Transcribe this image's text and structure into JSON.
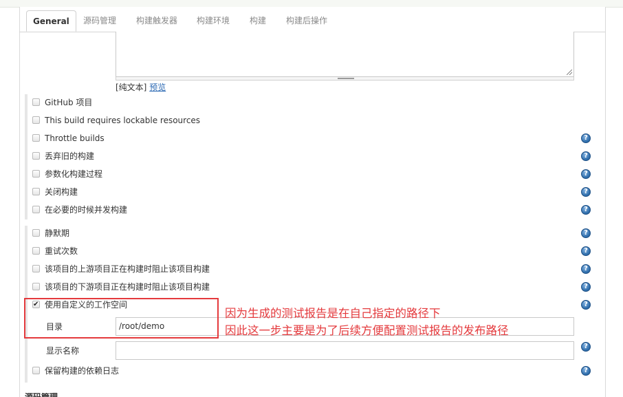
{
  "tabs": [
    {
      "label": "General",
      "active": true
    },
    {
      "label": "源码管理"
    },
    {
      "label": "构建触发器"
    },
    {
      "label": "构建环境"
    },
    {
      "label": "构建"
    },
    {
      "label": "构建后操作"
    }
  ],
  "description": {
    "value": "",
    "plain_text": "[纯文本]",
    "preview": "预览"
  },
  "options_group1": [
    {
      "label": "GitHub 项目",
      "checked": false,
      "help": false
    },
    {
      "label": "This build requires lockable resources",
      "checked": false,
      "help": false
    },
    {
      "label": "Throttle builds",
      "checked": false,
      "help": true
    },
    {
      "label": "丢弃旧的构建",
      "checked": false,
      "help": true
    },
    {
      "label": "参数化构建过程",
      "checked": false,
      "help": true
    },
    {
      "label": "关闭构建",
      "checked": false,
      "help": true
    },
    {
      "label": "在必要的时候并发构建",
      "checked": false,
      "help": true
    }
  ],
  "options_group2": [
    {
      "label": "静默期",
      "checked": false,
      "help": true
    },
    {
      "label": "重试次数",
      "checked": false,
      "help": true
    },
    {
      "label": "该项目的上游项目正在构建时阻止该项目构建",
      "checked": false,
      "help": true
    },
    {
      "label": "该项目的下游项目正在构建时阻止该项目构建",
      "checked": false,
      "help": true
    },
    {
      "label": "使用自定义的工作空间",
      "checked": true,
      "help": true
    }
  ],
  "custom_workspace": {
    "dir_label": "目录",
    "dir_value": "/root/demo",
    "display_name_label": "显示名称",
    "display_name_value": ""
  },
  "keep_deps": {
    "label": "保留构建的依赖日志",
    "checked": false
  },
  "annotation": {
    "line1": "因为生成的测试报告是在自己指定的路径下",
    "line2": "因此这一步主要是为了后续方便配置测试报告的发布路径"
  },
  "help_glyph": "?",
  "bottom_section": "源码管理",
  "colors": {
    "annotation": "#e4393c",
    "help_icon": "#2b6aa8",
    "link": "#2d6ab4"
  }
}
